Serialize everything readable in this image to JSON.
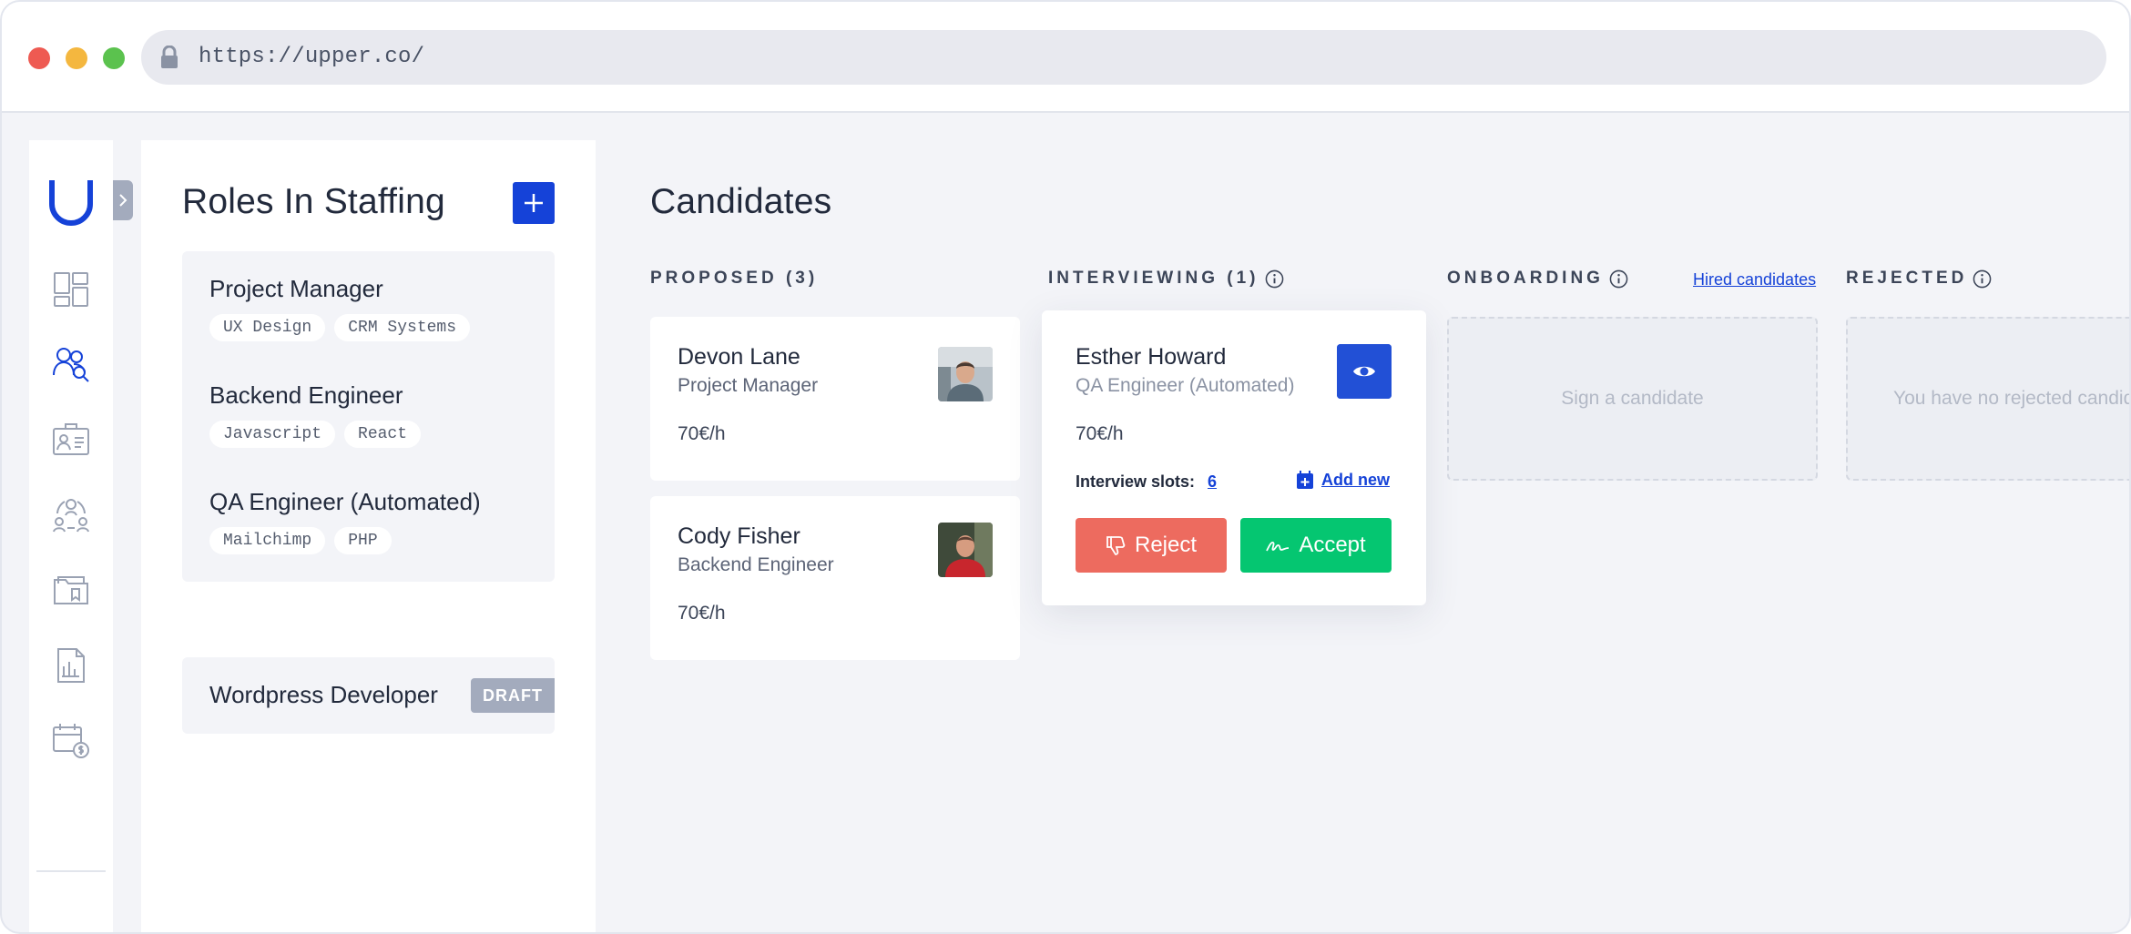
{
  "browser": {
    "url": "https://upper.co/"
  },
  "nav": {
    "items": [
      {
        "name": "dashboard-icon"
      },
      {
        "name": "candidates-icon",
        "active": true
      },
      {
        "name": "profile-card-icon"
      },
      {
        "name": "team-icon"
      },
      {
        "name": "folder-icon"
      },
      {
        "name": "reports-icon"
      },
      {
        "name": "billing-calendar-icon"
      }
    ]
  },
  "roles": {
    "title": "Roles In Staffing",
    "items": [
      {
        "title": "Project Manager",
        "tags": [
          "UX Design",
          "CRM Systems"
        ]
      },
      {
        "title": "Backend Engineer",
        "tags": [
          "Javascript",
          "React"
        ]
      },
      {
        "title": "QA Engineer (Automated)",
        "tags": [
          "Mailchimp",
          "PHP"
        ]
      }
    ],
    "draft": {
      "title": "Wordpress Developer",
      "badge": "DRAFT"
    }
  },
  "board": {
    "title": "Candidates",
    "columns": {
      "proposed": "PROPOSED (3)",
      "interviewing": "INTERVIEWING (1)",
      "onboarding": "ONBOARDING",
      "rejected": "REJECTED"
    },
    "hired_link": "Hired candidates",
    "proposed": [
      {
        "name": "Devon Lane",
        "role": "Project Manager",
        "rate": "70€/h"
      },
      {
        "name": "Cody Fisher",
        "role": "Backend Engineer",
        "rate": "70€/h"
      }
    ],
    "interviewing": {
      "name": "Esther Howard",
      "role": "QA Engineer (Automated)",
      "rate": "70€/h",
      "slots_label": "Interview slots:",
      "slots_count": "6",
      "add_new": "Add new",
      "reject": "Reject",
      "accept": "Accept"
    },
    "onboarding_empty": "Sign a candidate",
    "rejected_empty": "You have no rejected candidates"
  },
  "colors": {
    "accent": "#1542d8",
    "reject": "#ed6b5f",
    "accept": "#05c671",
    "badge": "#a3abbd"
  }
}
